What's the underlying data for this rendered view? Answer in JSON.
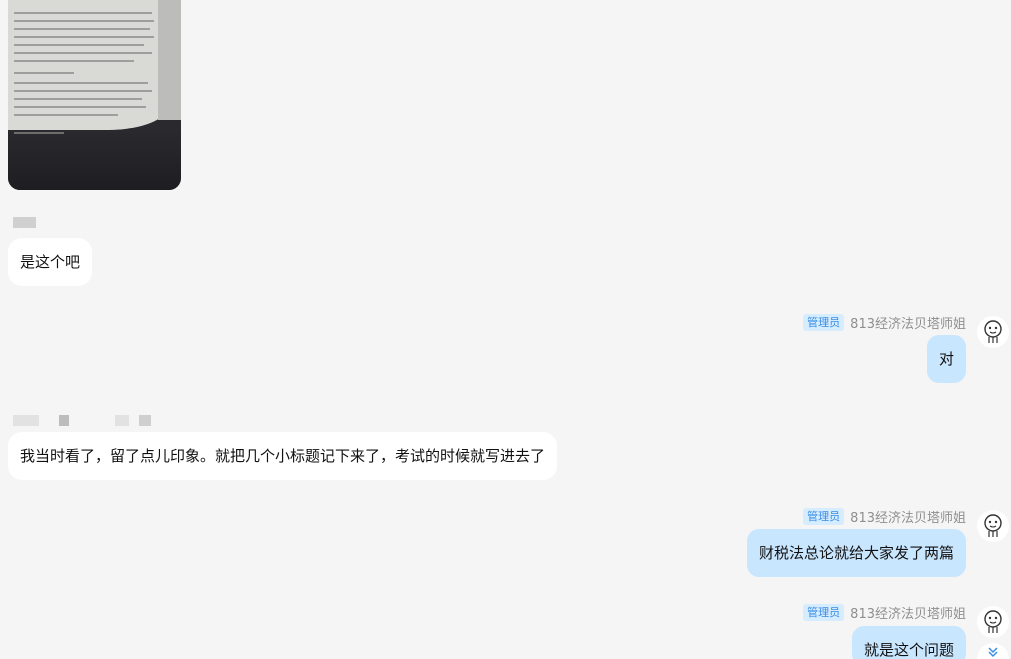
{
  "messages": {
    "reply1": "是这个吧",
    "admin1": "对",
    "reply2": "我当时看了，留了点儿印象。就把几个小标题记下来了，考试的时候就写进去了",
    "admin2": "财税法总论就给大家发了两篇",
    "admin3": "就是这个问题"
  },
  "admin": {
    "badge": "管理员",
    "name": "813经济法贝塔师姐"
  },
  "icons": {
    "avatar": "cartoon-face-icon",
    "scroll": "double-chevron-down-icon"
  },
  "colors": {
    "background": "#f5f5f5",
    "left_bubble": "#ffffff",
    "right_bubble": "#c9e6ff",
    "badge_bg": "#d6ecff",
    "badge_text": "#3a8ee6"
  }
}
